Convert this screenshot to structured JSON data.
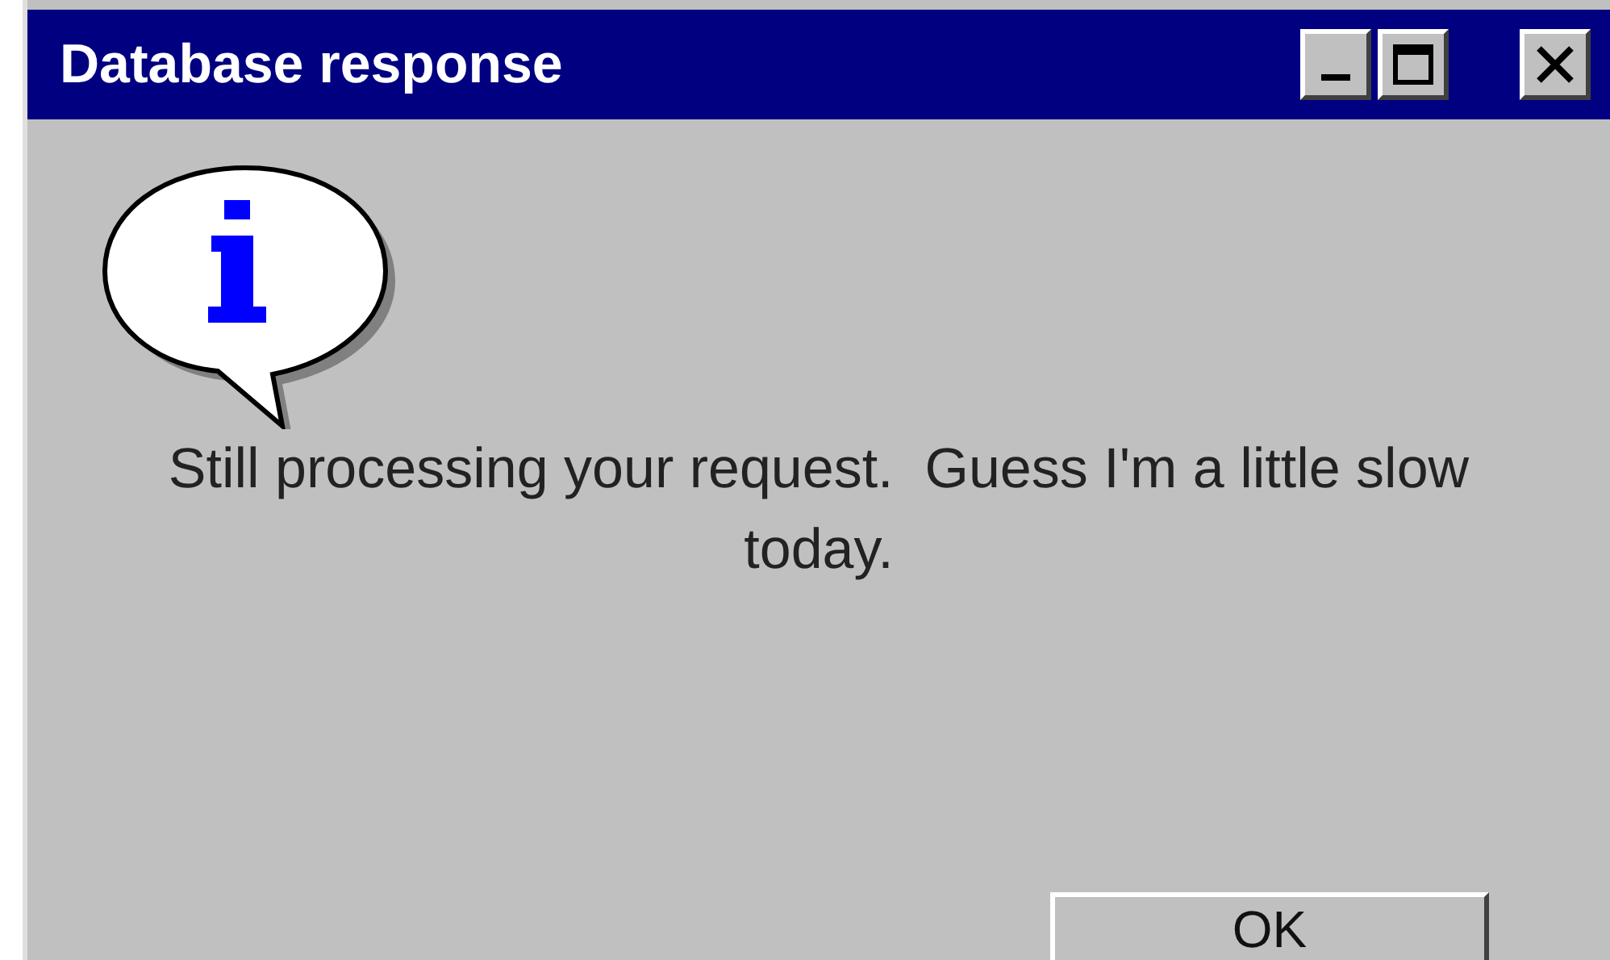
{
  "window": {
    "title": "Database response"
  },
  "message": "Still processing your request.  Guess I'm a little slow today.",
  "buttons": [
    "OK"
  ]
}
